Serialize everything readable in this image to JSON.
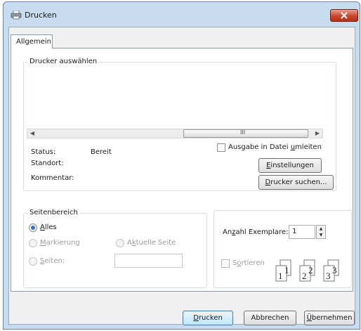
{
  "window": {
    "title": "Drucken",
    "icon": "printer-icon"
  },
  "tabs": [
    {
      "label": "Allgemein"
    }
  ],
  "printer_group": {
    "title": "Drucker auswählen",
    "scroll_mid_glyph": "III",
    "status_label": "Status:",
    "status_value": "Bereit",
    "location_label": "Standort:",
    "comment_label": "Kommentar:",
    "print_to_file_pre": "Ausgabe in Datei ",
    "print_to_file_u": "u",
    "print_to_file_post": "mleiten",
    "settings_u": "E",
    "settings_rest": "instellungen",
    "find_u": "D",
    "find_rest": "rucker suchen..."
  },
  "range_group": {
    "title": "Seitenbereich",
    "all_u": "A",
    "all_rest": "lles",
    "selection_u": "M",
    "selection_rest": "arkierung",
    "current_pre": "A",
    "current_u": "k",
    "current_rest": "tuelle Seite",
    "pages_u": "S",
    "pages_rest": "eiten:",
    "pages_value": ""
  },
  "copies_group": {
    "copies_pre": "An",
    "copies_u": "z",
    "copies_post": "ahl Exemplare:",
    "copies_value": "1",
    "collate_pre": "S",
    "collate_u": "o",
    "collate_post": "rtieren"
  },
  "buttons": {
    "print_u": "D",
    "print_rest": "rucken",
    "cancel": "Abbrechen",
    "apply_u": "Ü",
    "apply_rest": "bernehmen"
  },
  "colors": {
    "title_bg": "#c8dcef",
    "close_red": "#c9462c",
    "accent": "#3a76c0"
  }
}
